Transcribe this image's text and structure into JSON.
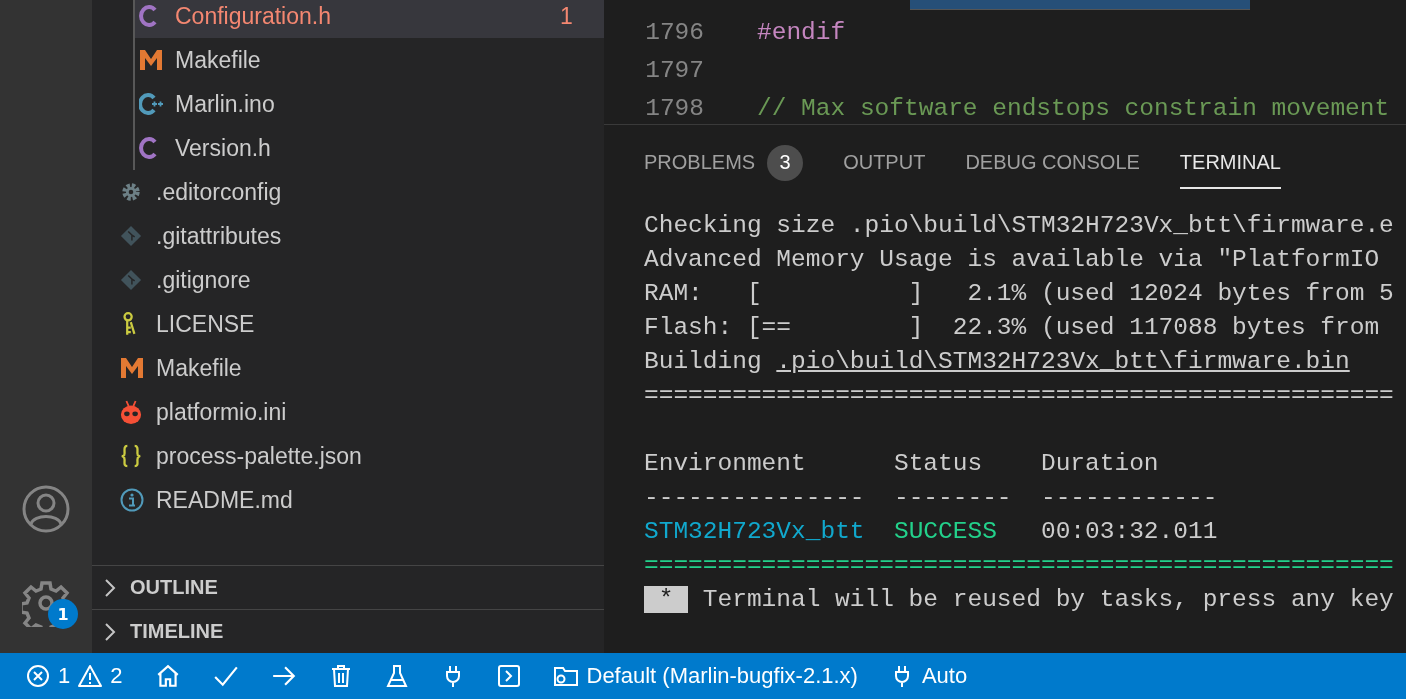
{
  "explorer": {
    "nested_items": [
      {
        "name": "Configuration.h",
        "kind": "c",
        "selected": true,
        "error_count": "1"
      },
      {
        "name": "Makefile",
        "kind": "make",
        "selected": false
      },
      {
        "name": "Marlin.ino",
        "kind": "cpp",
        "selected": false
      },
      {
        "name": "Version.h",
        "kind": "c",
        "selected": false
      }
    ],
    "items": [
      {
        "name": ".editorconfig",
        "kind": "gear",
        "selected": false
      },
      {
        "name": ".gitattributes",
        "kind": "git",
        "selected": false
      },
      {
        "name": ".gitignore",
        "kind": "git",
        "selected": false
      },
      {
        "name": "LICENSE",
        "kind": "key",
        "selected": false
      },
      {
        "name": "Makefile",
        "kind": "make",
        "selected": false
      },
      {
        "name": "platformio.ini",
        "kind": "pio",
        "selected": false
      },
      {
        "name": "process-palette.json",
        "kind": "json",
        "selected": false
      },
      {
        "name": "README.md",
        "kind": "info",
        "selected": false
      }
    ],
    "sections": [
      {
        "label": "OUTLINE",
        "expanded": false
      },
      {
        "label": "TIMELINE",
        "expanded": false
      }
    ]
  },
  "activity_bar": {
    "settings_badge": "1"
  },
  "editor": {
    "lines": [
      {
        "number": "1796",
        "kind": "preprocessor",
        "text": "#endif"
      },
      {
        "number": "1797",
        "kind": "blank"
      },
      {
        "number": "1798",
        "kind": "comment",
        "text": "// Max software endstops constrain movement"
      }
    ]
  },
  "panel": {
    "tabs": [
      {
        "label": "PROBLEMS",
        "badge": "3",
        "selected": false
      },
      {
        "label": "OUTPUT",
        "selected": false
      },
      {
        "label": "DEBUG CONSOLE",
        "selected": false
      },
      {
        "label": "TERMINAL",
        "selected": true
      }
    ],
    "terminal": {
      "lines": [
        {
          "kind": "plain",
          "text": "Checking size .pio\\build\\STM32H723Vx_btt\\firmware.e"
        },
        {
          "kind": "plain",
          "text": "Advanced Memory Usage is available via \"PlatformIO"
        },
        {
          "kind": "plain",
          "text": "RAM:   [          ]   2.1% (used 12024 bytes from 5"
        },
        {
          "kind": "plain",
          "text": "Flash: [==        ]  22.3% (used 117088 bytes from"
        },
        {
          "kind": "link",
          "text": "Building ",
          "link": ".pio\\build\\STM32H723Vx_btt\\firmware.bin"
        },
        {
          "kind": "rule",
          "text": "==================================================="
        }
      ],
      "table": {
        "columns": [
          "Environment",
          "Status",
          "Duration"
        ],
        "separators": [
          "---------------",
          "--------",
          "------------"
        ],
        "rows": [
          {
            "environment": "STM32H723Vx_btt",
            "status": "SUCCESS",
            "kind": "success",
            "duration": "00:03:32.011"
          }
        ]
      },
      "footer_rule": "===================================================",
      "notice": {
        "badge": "*",
        "text": "Terminal will be reused by tasks, press any key"
      }
    }
  },
  "status_bar": {
    "errors": "1",
    "warnings": "2",
    "profile": "Default (Marlin-bugfix-2.1.x)",
    "port": "Auto"
  }
}
